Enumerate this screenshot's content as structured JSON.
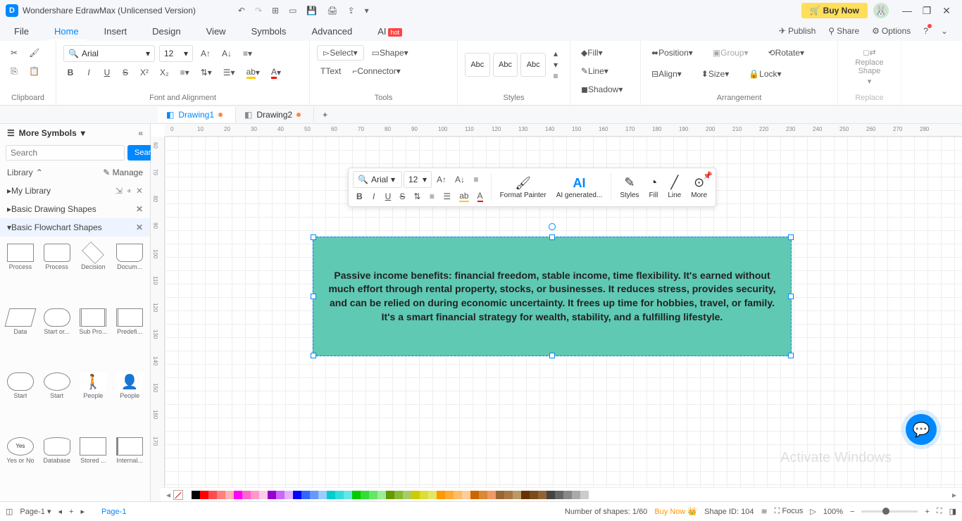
{
  "titlebar": {
    "app_title": "Wondershare EdrawMax (Unlicensed Version)",
    "buy_label": "Buy Now"
  },
  "menu": {
    "file": "File",
    "home": "Home",
    "insert": "Insert",
    "design": "Design",
    "view": "View",
    "symbols": "Symbols",
    "advanced": "Advanced",
    "ai": "AI",
    "hot": "hot",
    "publish": "Publish",
    "share": "Share",
    "options": "Options"
  },
  "ribbon": {
    "clipboard_label": "Clipboard",
    "font_name": "Arial",
    "font_size": "12",
    "font_align_label": "Font and Alignment",
    "select_label": "Select",
    "shape_label": "Shape",
    "text_label": "Text",
    "connector_label": "Connector",
    "tools_label": "Tools",
    "theme_chip": "Abc",
    "styles_label": "Styles",
    "fill_label": "Fill",
    "line_label": "Line",
    "shadow_label": "Shadow",
    "position_label": "Position",
    "align_label": "Align",
    "group_label": "Group",
    "size_label": "Size",
    "rotate_label": "Rotate",
    "lock_label": "Lock",
    "arrangement_label": "Arrangement",
    "replace_shape": "Replace Shape",
    "replace_label": "Replace"
  },
  "doctabs": {
    "d1": "Drawing1",
    "d2": "Drawing2"
  },
  "sidebar": {
    "more_symbols": "More Symbols",
    "search_placeholder": "Search",
    "search_btn": "Search",
    "library": "Library",
    "manage": "Manage",
    "my_library": "My Library",
    "basic_drawing": "Basic Drawing Shapes",
    "basic_flowchart": "Basic Flowchart Shapes",
    "shapes": [
      "Process",
      "Process",
      "Decision",
      "Docum...",
      "Data",
      "Start or...",
      "Sub Pro...",
      "Predefi...",
      "Start",
      "Start",
      "People",
      "People",
      "Yes or No",
      "Database",
      "Stored ...",
      "Internal..."
    ]
  },
  "float_toolbar": {
    "font_name": "Arial",
    "font_size": "12",
    "format_painter": "Format Painter",
    "ai_gen": "AI generated...",
    "styles": "Styles",
    "fill": "Fill",
    "line": "Line",
    "more": "More"
  },
  "canvas": {
    "text_content": "Passive income benefits: financial freedom, stable income, time flexibility. It's earned without much effort through rental property, stocks, or businesses. It reduces stress, provides security, and can be relied on during economic uncertainty. It frees up time for hobbies, travel, or family. It's a smart financial strategy for wealth, stability, and a fulfilling lifestyle."
  },
  "status": {
    "page_tab": "Page-1",
    "page_active": "Page-1",
    "num_shapes_label": "Number of shapes:",
    "num_shapes_value": "1/60",
    "buy_now": "Buy Now",
    "shape_id_label": "Shape ID:",
    "shape_id_value": "104",
    "focus": "Focus",
    "zoom": "100%"
  },
  "watermark": "Activate Windows",
  "ruler_h": [
    "0",
    "10",
    "20",
    "30",
    "40",
    "50",
    "60",
    "70",
    "80",
    "90",
    "100",
    "110",
    "120",
    "130",
    "140",
    "150",
    "160",
    "170",
    "180",
    "190",
    "200",
    "210",
    "220",
    "230",
    "240",
    "250",
    "260",
    "270",
    "280"
  ],
  "ruler_v": [
    "60",
    "70",
    "80",
    "90",
    "100",
    "110",
    "120",
    "130",
    "140",
    "150",
    "160",
    "170"
  ],
  "colors": [
    "#ffffff",
    "#000000",
    "#ff0000",
    "#ff4d4d",
    "#ff8080",
    "#ffb3b3",
    "#ff00ff",
    "#ff66cc",
    "#ff99cc",
    "#ffcce6",
    "#9900cc",
    "#cc66ff",
    "#e0b3ff",
    "#0000ff",
    "#3366ff",
    "#6699ff",
    "#99ccff",
    "#00cccc",
    "#33dddd",
    "#66e6e6",
    "#00cc00",
    "#33dd33",
    "#66e666",
    "#99ee99",
    "#669900",
    "#88bb33",
    "#aacc66",
    "#cccc00",
    "#dddd33",
    "#e6e666",
    "#ff9900",
    "#ffaa33",
    "#ffbb66",
    "#ffcc99",
    "#cc6600",
    "#dd8833",
    "#ee9966",
    "#996633",
    "#aa7744",
    "#bb9966",
    "#663300",
    "#7a4d1a",
    "#8f6633",
    "#444444",
    "#666666",
    "#888888",
    "#aaaaaa",
    "#cccccc"
  ]
}
